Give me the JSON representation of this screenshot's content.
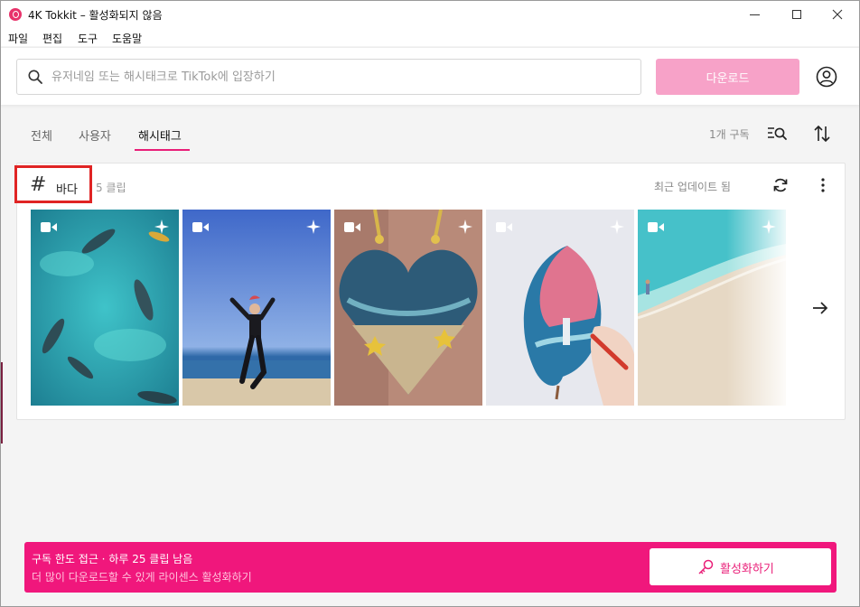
{
  "window": {
    "title": "4K Tokkit – 활성화되지 않음",
    "controls": {
      "minimize": "minimize",
      "maximize": "maximize",
      "close": "close"
    }
  },
  "menu": [
    "파일",
    "편집",
    "도구",
    "도움말"
  ],
  "search": {
    "placeholder": "유저네임 또는 해시태크로 TikTok에 입장하기",
    "value": ""
  },
  "download_button": "다운로드",
  "tabs": [
    {
      "label": "전체",
      "active": false
    },
    {
      "label": "사용자",
      "active": false
    },
    {
      "label": "해시태그",
      "active": true
    }
  ],
  "subscription_count": "1개 구독",
  "subscription": {
    "hashtag": "바다",
    "clip_count": "5 클립",
    "status": "최근 업데이트 됨",
    "thumbnails": [
      {
        "name": "fish-underwater",
        "icons": [
          "video-icon",
          "sparkle-icon"
        ]
      },
      {
        "name": "woman-on-beach",
        "icons": [
          "video-icon",
          "sparkle-icon"
        ]
      },
      {
        "name": "heart-resin-pendant",
        "icons": [
          "video-icon",
          "sparkle-icon"
        ]
      },
      {
        "name": "painted-leaf",
        "icons": [
          "video-icon",
          "sparkle-icon"
        ]
      },
      {
        "name": "beach-shore",
        "icons": [
          "video-icon",
          "sparkle-icon"
        ]
      }
    ]
  },
  "banner": {
    "title": "구독 한도 접근 · 하루 25 클립 남음",
    "subtitle": "더 많이 다운로드할 수 있게 라이센스 활성화하기",
    "button": "활성화하기"
  },
  "colors": {
    "accent": "#e91e78",
    "banner": "#f0177c",
    "download_disabled": "#f7a2c8",
    "highlight": "#e02424"
  }
}
